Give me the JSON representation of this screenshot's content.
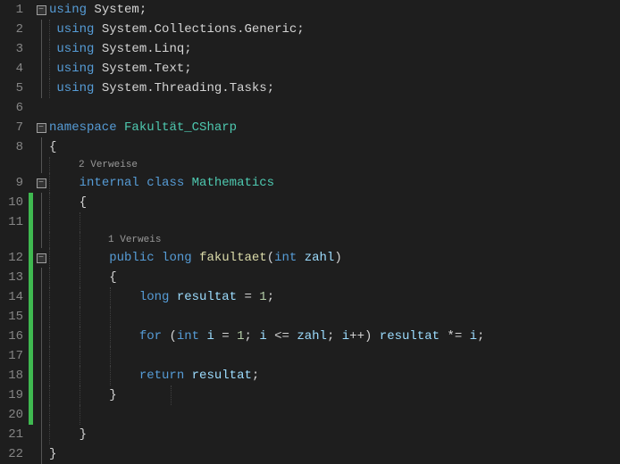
{
  "lines": {
    "l1": "1",
    "l2": "2",
    "l3": "3",
    "l4": "4",
    "l5": "5",
    "l6": "6",
    "l7": "7",
    "l8": "8",
    "l9": "9",
    "l10": "10",
    "l11": "11",
    "l12": "12",
    "l13": "13",
    "l14": "14",
    "l15": "15",
    "l16": "16",
    "l17": "17",
    "l18": "18",
    "l19": "19",
    "l20": "20",
    "l21": "21",
    "l22": "22"
  },
  "codelens": {
    "refs2": "2 Verweise",
    "refs1": "1 Verweis"
  },
  "kw": {
    "using": "using",
    "namespace": "namespace",
    "internal": "internal",
    "class": "class",
    "public": "public",
    "long": "long",
    "int": "int",
    "for": "for",
    "return": "return"
  },
  "id": {
    "System": "System",
    "Collections": "Collections",
    "Generic": "Generic",
    "Linq": "Linq",
    "Text": "Text",
    "Threading": "Threading",
    "Tasks": "Tasks",
    "ns": "Fakultät_CSharp",
    "Mathematics": "Mathematics",
    "fakultaet": "fakultaet",
    "zahl": "zahl",
    "resultat": "resultat",
    "i": "i"
  },
  "sym": {
    "semi": ";",
    "dot": ".",
    "obrace": "{",
    "cbrace": "}",
    "oparen": "(",
    "cparen": ")",
    "eq": " = ",
    "one": "1",
    "le": " <= ",
    "pp": "++",
    "mule": " *= ",
    "sep": "; "
  },
  "fold": {
    "minus": "−"
  }
}
